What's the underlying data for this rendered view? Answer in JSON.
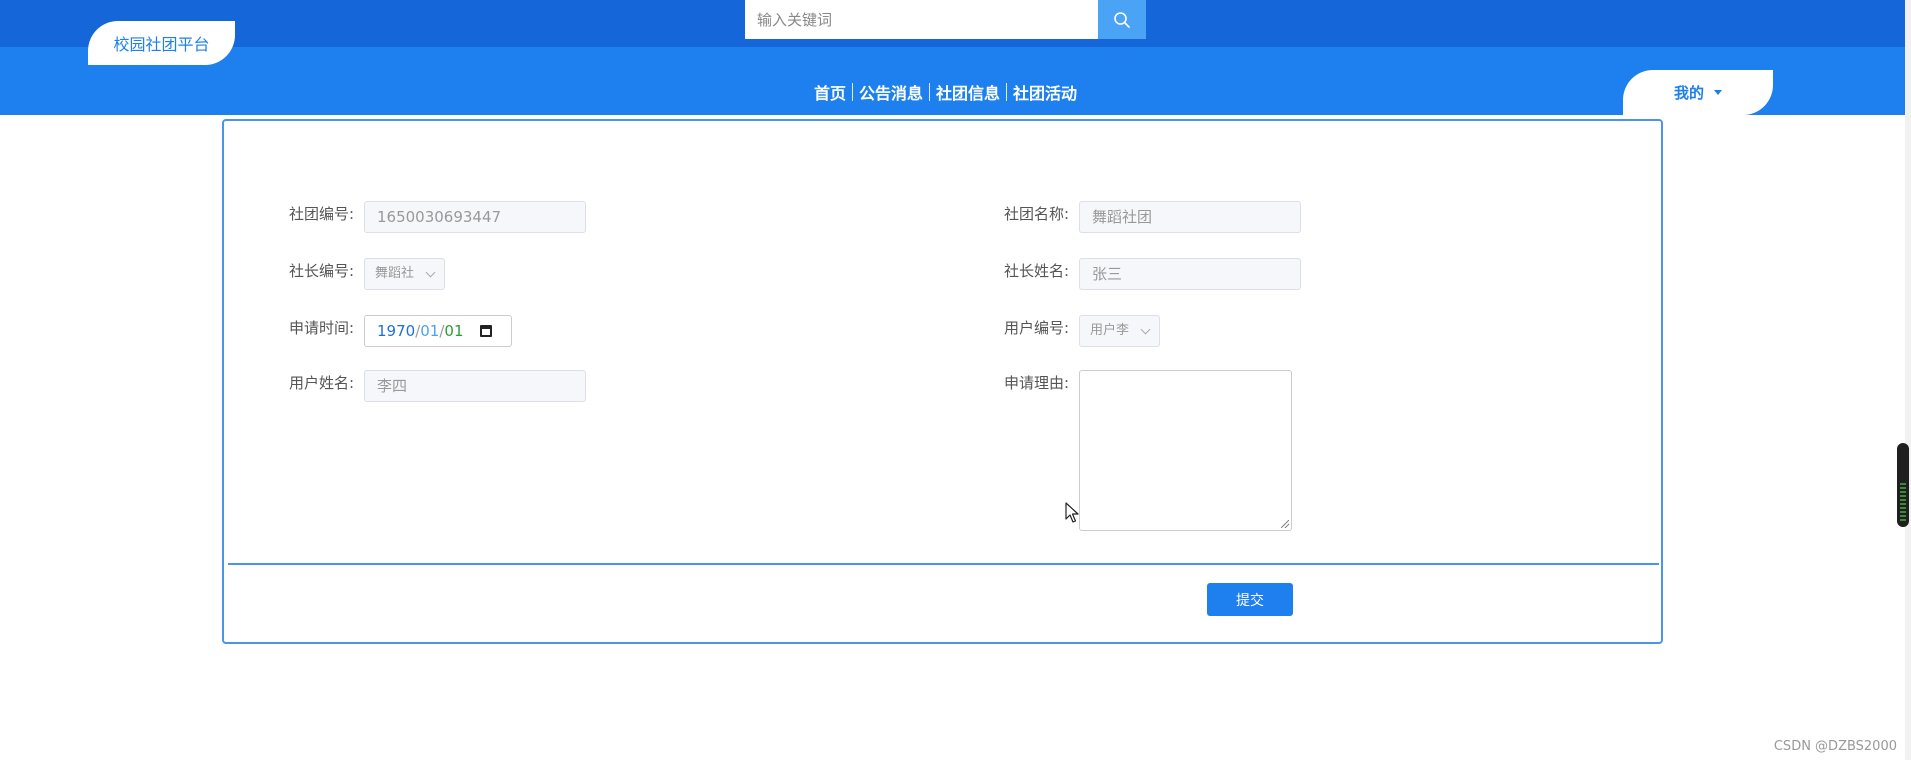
{
  "header": {
    "logo_text": "校园社团平台",
    "search": {
      "placeholder": "输入关键词",
      "icon": "search-icon"
    },
    "nav": [
      {
        "label": "首页"
      },
      {
        "label": "公告消息"
      },
      {
        "label": "社团信息"
      },
      {
        "label": "社团活动"
      }
    ],
    "mine_label": "我的",
    "colors": {
      "topbar": "#1566d8",
      "navbar": "#1e80ee"
    }
  },
  "form": {
    "club_id": {
      "label": "社团编号:",
      "value": "1650030693447"
    },
    "club_name": {
      "label": "社团名称:",
      "value": "舞蹈社团"
    },
    "president_id": {
      "label": "社长编号:",
      "value": "舞蹈社"
    },
    "president_name": {
      "label": "社长姓名:",
      "value": "张三"
    },
    "apply_time": {
      "label": "申请时间:",
      "year": "1970",
      "month": "01",
      "day": "01",
      "sep": "/"
    },
    "user_id": {
      "label": "用户编号:",
      "value": "用户李"
    },
    "user_name": {
      "label": "用户姓名:",
      "value": "李四"
    },
    "reason": {
      "label": "申请理由:",
      "value": ""
    },
    "submit_label": "提交"
  },
  "watermark": "CSDN @DZBS2000"
}
